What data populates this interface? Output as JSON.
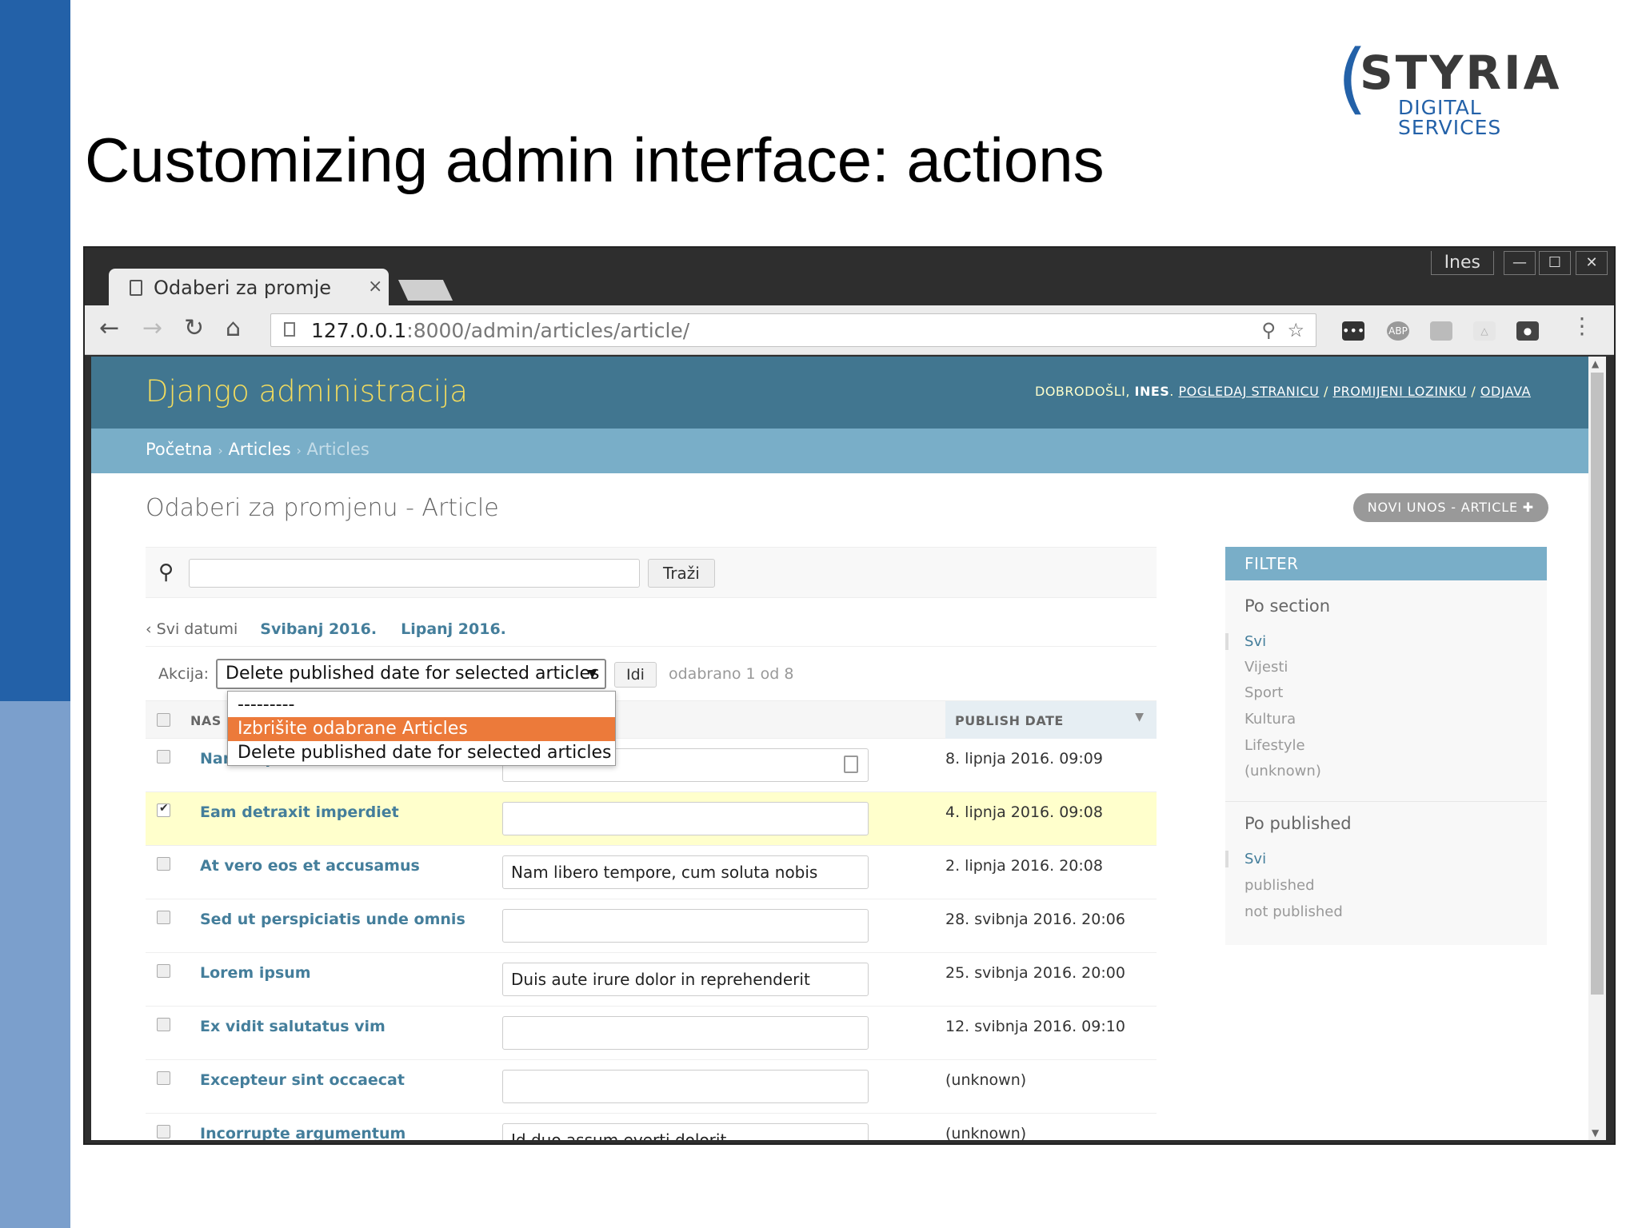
{
  "slide": {
    "title": "Customizing admin interface: actions",
    "logo_main": "STYRIA",
    "logo_sub": "DIGITAL SERVICES",
    "colors": {
      "band_dark": "#2361a8",
      "band_light": "#7b9fcc"
    }
  },
  "window": {
    "user": "Ines",
    "minimize": "—",
    "maximize": "☐",
    "close": "✕"
  },
  "tab": {
    "title": "Odaberi za promje",
    "close": "×"
  },
  "toolbar": {
    "back_icon": "arrow-left-icon",
    "forward_icon": "arrow-right-icon",
    "reload_icon": "reload-icon",
    "home_icon": "home-icon",
    "url_host": "127.0.0.1",
    "url_rest": ":8000/admin/articles/article/",
    "ext_abp": "ABP"
  },
  "admin": {
    "brand": "Django administracija",
    "welcome": "DOBRODOŠLI,",
    "user": "INES",
    "view_site": "POGLEDAJ STRANICU",
    "change_password": "PROMIJENI LOZINKU",
    "logout": "ODJAVA",
    "sep": "/",
    "colors": {
      "header": "#417690",
      "brand": "#f5dd5d",
      "breadcrumbs": "#79aec8",
      "link": "#447e9b",
      "selected_option": "#ec7a3a",
      "selected_row": "#ffffcc"
    }
  },
  "breadcrumbs": {
    "home": "Početna",
    "app": "Articles",
    "current": "Articles",
    "sep": "›"
  },
  "page": {
    "title": "Odaberi za promjenu - Article",
    "add_button": "NOVI UNOS - ARTICLE"
  },
  "search": {
    "value": "",
    "button": "Traži"
  },
  "date_hierarchy": {
    "all": "‹ Svi datumi",
    "links": [
      "Svibanj 2016.",
      "Lipanj 2016."
    ]
  },
  "actions": {
    "label": "Akcija:",
    "selected": "Delete published date for selected articles",
    "go": "Idi",
    "count": "odabrano 1 od 8",
    "options": [
      "---------",
      "Izbrišite odabrane Articles",
      "Delete published date for selected articles"
    ],
    "highlighted_index": 1
  },
  "table": {
    "col_title": "NAS",
    "col_publish": "PUBLISH DATE",
    "rows": [
      {
        "title": "Nam impedit",
        "summary": "",
        "date": "8. lipnja 2016. 09:09",
        "checked": false
      },
      {
        "title": "Eam detraxit imperdiet",
        "summary": "",
        "date": "4. lipnja 2016. 09:08",
        "checked": true
      },
      {
        "title": "At vero eos et accusamus",
        "summary": "Nam libero tempore, cum soluta nobis",
        "date": "2. lipnja 2016. 20:08",
        "checked": false
      },
      {
        "title": "Sed ut perspiciatis unde omnis",
        "summary": "",
        "date": "28. svibnja 2016. 20:06",
        "checked": false
      },
      {
        "title": "Lorem ipsum",
        "summary": "Duis aute irure dolor in reprehenderit",
        "date": "25. svibnja 2016. 20:00",
        "checked": false
      },
      {
        "title": "Ex vidit salutatus vim",
        "summary": "",
        "date": "12. svibnja 2016. 09:10",
        "checked": false
      },
      {
        "title": "Excepteur sint occaecat",
        "summary": "",
        "date": "(unknown)",
        "checked": false
      },
      {
        "title": "Incorrupte argumentum",
        "summary": "Id duo assum everti dolorit",
        "date": "(unknown)",
        "checked": false
      }
    ]
  },
  "filter": {
    "header": "FILTER",
    "by_section": "Po section",
    "section_items": [
      "Svi",
      "Vijesti",
      "Sport",
      "Kultura",
      "Lifestyle",
      "(unknown)"
    ],
    "by_published": "Po published",
    "published_items": [
      "Svi",
      "published",
      "not published"
    ]
  }
}
